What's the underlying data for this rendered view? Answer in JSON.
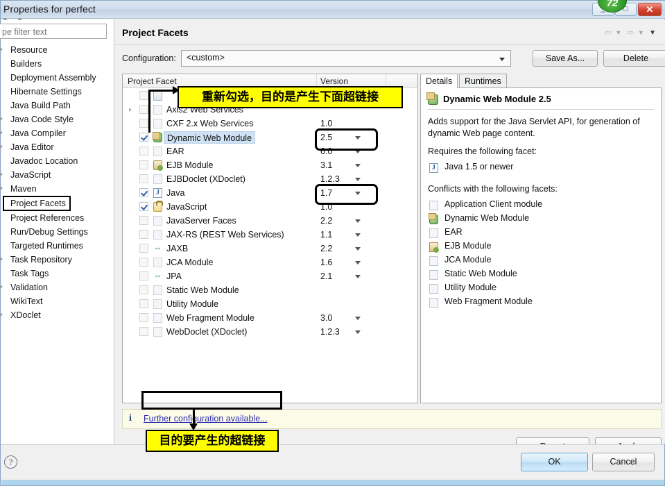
{
  "window": {
    "title": "Properties for perfect",
    "minimize_label": "–",
    "maximize_label": "□",
    "close_label": "✕",
    "badge_value": "72"
  },
  "sidebar": {
    "filter": {
      "value": "",
      "placeholder": "pe filter text"
    },
    "items": [
      {
        "label": "Resource",
        "expandable": true,
        "selected": false
      },
      {
        "label": "Builders",
        "expandable": false,
        "selected": false
      },
      {
        "label": "Deployment Assembly",
        "expandable": false,
        "selected": false
      },
      {
        "label": "Hibernate Settings",
        "expandable": false,
        "selected": false
      },
      {
        "label": "Java Build Path",
        "expandable": false,
        "selected": false
      },
      {
        "label": "Java Code Style",
        "expandable": true,
        "selected": false
      },
      {
        "label": "Java Compiler",
        "expandable": true,
        "selected": false
      },
      {
        "label": "Java Editor",
        "expandable": true,
        "selected": false
      },
      {
        "label": "Javadoc Location",
        "expandable": false,
        "selected": false
      },
      {
        "label": "JavaScript",
        "expandable": true,
        "selected": false
      },
      {
        "label": "Maven",
        "expandable": true,
        "selected": false
      },
      {
        "label": "Project Facets",
        "expandable": false,
        "selected": true
      },
      {
        "label": "Project References",
        "expandable": false,
        "selected": false
      },
      {
        "label": "Run/Debug Settings",
        "expandable": false,
        "selected": false
      },
      {
        "label": "Targeted Runtimes",
        "expandable": false,
        "selected": false
      },
      {
        "label": "Task Repository",
        "expandable": true,
        "selected": false
      },
      {
        "label": "Task Tags",
        "expandable": false,
        "selected": false
      },
      {
        "label": "Validation",
        "expandable": true,
        "selected": false
      },
      {
        "label": "WikiText",
        "expandable": false,
        "selected": false
      },
      {
        "label": "XDoclet",
        "expandable": true,
        "selected": false
      }
    ]
  },
  "page": {
    "title": "Project Facets",
    "toolbar": {
      "back_icon": "back-arrow-icon",
      "forward_icon": "forward-arrow-icon",
      "menu_icon": "chevron-down-icon"
    }
  },
  "configuration": {
    "label": "Configuration:",
    "value": "<custom>",
    "save_as_label": "Save As...",
    "delete_label": "Delete"
  },
  "facet_table": {
    "columns": {
      "facet": "Project Facet",
      "version": "Version"
    },
    "rows": [
      {
        "name": "",
        "version": "",
        "checked": false,
        "icon": "doc",
        "expandable": false,
        "hidden_by_annotation": true,
        "selected": false,
        "has_dropdown": false
      },
      {
        "name": "Axis2 Web Services",
        "version": "",
        "checked": false,
        "icon": "doc-pale",
        "expandable": true,
        "selected": false,
        "has_dropdown": false
      },
      {
        "name": "CXF 2.x Web Services",
        "version": "1.0",
        "checked": false,
        "icon": "doc-pale",
        "expandable": false,
        "selected": false,
        "has_dropdown": false
      },
      {
        "name": "Dynamic Web Module",
        "version": "2.5",
        "checked": true,
        "icon": "globe",
        "expandable": false,
        "selected": true,
        "has_dropdown": true
      },
      {
        "name": "EAR",
        "version": "6.0",
        "checked": false,
        "icon": "doc-pale",
        "expandable": false,
        "selected": false,
        "has_dropdown": true
      },
      {
        "name": "EJB Module",
        "version": "3.1",
        "checked": false,
        "icon": "bean",
        "expandable": false,
        "selected": false,
        "has_dropdown": true
      },
      {
        "name": "EJBDoclet (XDoclet)",
        "version": "1.2.3",
        "checked": false,
        "icon": "doc-pale",
        "expandable": false,
        "selected": false,
        "has_dropdown": true
      },
      {
        "name": "Java",
        "version": "1.7",
        "checked": true,
        "icon": "jlogo",
        "expandable": false,
        "selected": false,
        "has_dropdown": true
      },
      {
        "name": "JavaScript",
        "version": "1.0",
        "checked": true,
        "icon": "lock",
        "expandable": false,
        "selected": false,
        "has_dropdown": false
      },
      {
        "name": "JavaServer Faces",
        "version": "2.2",
        "checked": false,
        "icon": "doc-pale",
        "expandable": false,
        "selected": false,
        "has_dropdown": true
      },
      {
        "name": "JAX-RS (REST Web Services)",
        "version": "1.1",
        "checked": false,
        "icon": "doc-pale",
        "expandable": false,
        "selected": false,
        "has_dropdown": true
      },
      {
        "name": "JAXB",
        "version": "2.2",
        "checked": false,
        "icon": "arrows",
        "expandable": false,
        "selected": false,
        "has_dropdown": true
      },
      {
        "name": "JCA Module",
        "version": "1.6",
        "checked": false,
        "icon": "doc-pale",
        "expandable": false,
        "selected": false,
        "has_dropdown": true
      },
      {
        "name": "JPA",
        "version": "2.1",
        "checked": false,
        "icon": "arrows",
        "expandable": false,
        "selected": false,
        "has_dropdown": true
      },
      {
        "name": "Static Web Module",
        "version": "",
        "checked": false,
        "icon": "doc-pale",
        "expandable": false,
        "selected": false,
        "has_dropdown": false
      },
      {
        "name": "Utility Module",
        "version": "",
        "checked": false,
        "icon": "doc-pale",
        "expandable": false,
        "selected": false,
        "has_dropdown": false
      },
      {
        "name": "Web Fragment Module",
        "version": "3.0",
        "checked": false,
        "icon": "doc-pale",
        "expandable": false,
        "selected": false,
        "has_dropdown": true
      },
      {
        "name": "WebDoclet (XDoclet)",
        "version": "1.2.3",
        "checked": false,
        "icon": "doc-pale",
        "expandable": false,
        "selected": false,
        "has_dropdown": true
      }
    ]
  },
  "details": {
    "tabs": [
      {
        "label": "Details",
        "active": true
      },
      {
        "label": "Runtimes",
        "active": false
      }
    ],
    "title": "Dynamic Web Module 2.5",
    "description": "Adds support for the Java Servlet API, for generation of dynamic Web page content.",
    "requires_heading": "Requires the following facet:",
    "requires": [
      {
        "label": "Java 1.5 or newer",
        "icon": "jlogo"
      }
    ],
    "conflicts_heading": "Conflicts with the following facets:",
    "conflicts": [
      {
        "label": "Application Client module",
        "icon": "doc"
      },
      {
        "label": "Dynamic Web Module",
        "icon": "globe"
      },
      {
        "label": "EAR",
        "icon": "doc"
      },
      {
        "label": "EJB Module",
        "icon": "bean"
      },
      {
        "label": "JCA Module",
        "icon": "doc"
      },
      {
        "label": "Static Web Module",
        "icon": "doc"
      },
      {
        "label": "Utility Module",
        "icon": "doc"
      },
      {
        "label": "Web Fragment Module",
        "icon": "doc"
      }
    ]
  },
  "info_bar": {
    "icon": "i",
    "link_label": "Further configuration available..."
  },
  "buttons": {
    "revert": "Revert",
    "apply": "Apply",
    "ok": "OK",
    "cancel": "Cancel",
    "help": "?"
  },
  "annotations": [
    {
      "text": "重新勾选，目的是产生下面超链接"
    },
    {
      "text": "目的要产生的超链接"
    }
  ],
  "colors": {
    "annotation_bg": "#ffff00",
    "selection_bg": "#cfe2f3",
    "link": "#2b2bb0",
    "info_bg": "#fbfbe8"
  }
}
